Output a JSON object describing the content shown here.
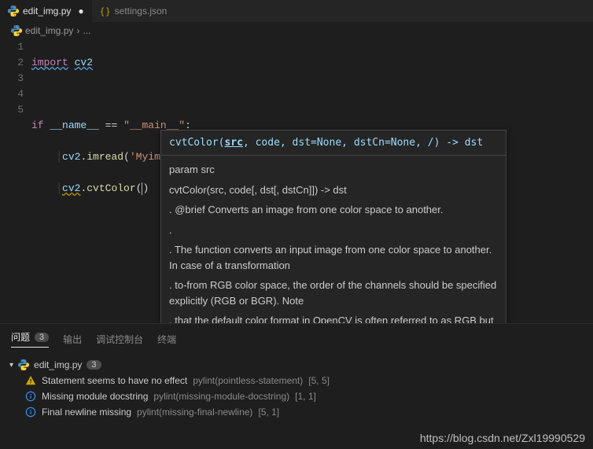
{
  "tabs": [
    {
      "label": "edit_img.py",
      "active": true,
      "modified": true,
      "icon": "python"
    },
    {
      "label": "settings.json",
      "active": false,
      "modified": false,
      "icon": "json"
    }
  ],
  "breadcrumb": {
    "file_icon": "python",
    "file": "edit_img.py",
    "sep": "›",
    "rest": "..."
  },
  "gutter": [
    "1",
    "2",
    "3",
    "4",
    "5"
  ],
  "code": {
    "l1_import": "import",
    "l1_cv2": "cv2",
    "l3_if": "if",
    "l3_name": "__name__",
    "l3_eq": "==",
    "l3_main": "\"__main__\"",
    "l3_colon": ":",
    "l4_cv2": "cv2",
    "l4_imread": "imread",
    "l4_arg": "'Myimage.jpg'",
    "l5_cv2": "cv2",
    "l5_cvtcolor": "cvtColor"
  },
  "tooltip": {
    "sig_full": "cvtColor(",
    "sig_active": "src",
    "sig_rest": ", code, dst=None, dstCn=None, /) -> dst",
    "param": "param src",
    "desc1": "cvtColor(src, code[, dst[, dstCn]]) -> dst",
    "desc2": ".   @brief Converts an image from one color space to another.",
    "desc3": ".",
    "desc4": ".   The function converts an input image from one color space to another. In case of a transformation",
    "desc5": ".   to-from RGB color space, the order of the channels should be specified explicitly (RGB or BGR). Note",
    "desc6": ".   that the default color format in OpenCV is often referred to as RGB but it is actually BGR (the"
  },
  "panel": {
    "tabs": [
      {
        "label": "问题",
        "badge": "3",
        "active": true
      },
      {
        "label": "输出",
        "badge": null,
        "active": false
      },
      {
        "label": "调试控制台",
        "badge": null,
        "active": false
      },
      {
        "label": "终端",
        "badge": null,
        "active": false
      }
    ],
    "file": {
      "name": "edit_img.py",
      "count": "3"
    },
    "problems": [
      {
        "severity": "warning",
        "msg": "Statement seems to have no effect",
        "source": "pylint(pointless-statement)",
        "loc": "[5, 5]"
      },
      {
        "severity": "info",
        "msg": "Missing module docstring",
        "source": "pylint(missing-module-docstring)",
        "loc": "[1, 1]"
      },
      {
        "severity": "info",
        "msg": "Final newline missing",
        "source": "pylint(missing-final-newline)",
        "loc": "[5, 1]"
      }
    ]
  },
  "watermark": "https://blog.csdn.net/Zxl19990529"
}
